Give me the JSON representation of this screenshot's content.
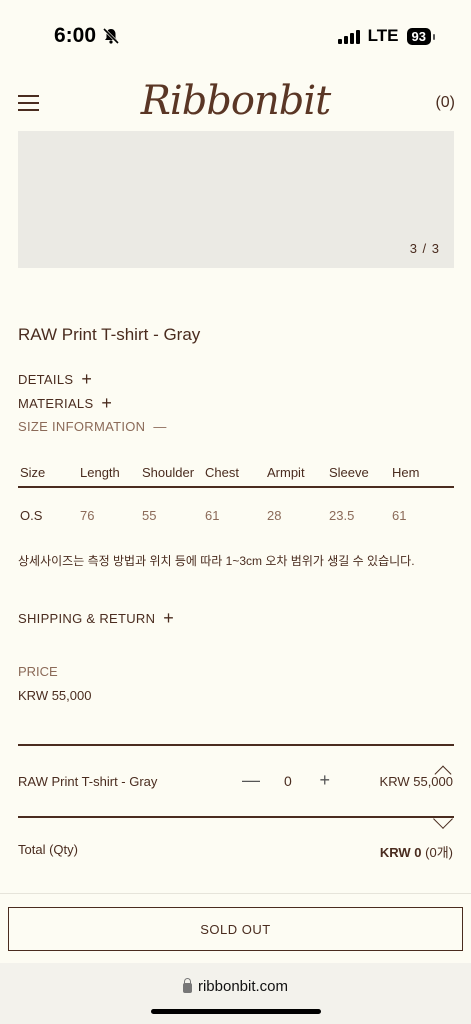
{
  "status_bar": {
    "time": "6:00",
    "network": "LTE",
    "battery": "93"
  },
  "header": {
    "logo": "Ribbonbit",
    "cart_count": "(0)"
  },
  "gallery": {
    "counter": "3 / 3"
  },
  "product": {
    "title": "RAW Print T-shirt - Gray"
  },
  "sections": {
    "details": "DETAILS",
    "materials": "MATERIALS",
    "size_information": "SIZE INFORMATION",
    "shipping_return": "SHIPPING & RETURN",
    "plus_symbol": "+",
    "minus_symbol": "—"
  },
  "size_table": {
    "headers": [
      "Size",
      "Length",
      "Shoulder",
      "Chest",
      "Armpit",
      "Sleeve",
      "Hem"
    ],
    "rows": [
      [
        "O.S",
        "76",
        "55",
        "61",
        "28",
        "23.5",
        "61"
      ]
    ]
  },
  "size_notice": "상세사이즈는 측정 방법과 위치 등에 따라 1~3cm 오차 범위가 생길 수 있습니다.",
  "price": {
    "label": "PRICE",
    "value": "KRW 55,000"
  },
  "option": {
    "name": "RAW Print T-shirt - Gray",
    "quantity": "0",
    "minus": "—",
    "plus": "+",
    "price": "KRW 55,000"
  },
  "total": {
    "label": "Total (Qty)",
    "amount": "KRW 0",
    "qty": "(0개)"
  },
  "cta": {
    "label": "SOLD OUT"
  },
  "browser": {
    "url": "ribbonbit.com"
  }
}
